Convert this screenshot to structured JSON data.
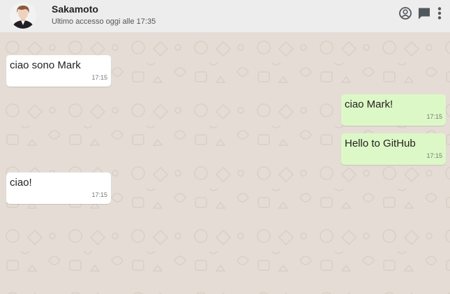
{
  "header": {
    "contact_name": "Sakamoto",
    "last_seen": "Ultimo accesso oggi alle 17:35",
    "icons": [
      "account-circle-icon",
      "chat-icon",
      "more-vertical-icon"
    ]
  },
  "messages": [
    {
      "direction": "in",
      "text": "ciao sono Mark",
      "time": "17:15"
    },
    {
      "direction": "out",
      "text": "ciao Mark!",
      "time": "17:15"
    },
    {
      "direction": "out",
      "text": "Hello to GitHub",
      "time": "17:15"
    },
    {
      "direction": "in",
      "text": "ciao!",
      "time": "17:15"
    }
  ],
  "colors": {
    "header_bg": "#ededed",
    "chat_bg": "#e5ddd5",
    "incoming_bubble": "#ffffff",
    "outgoing_bubble": "#dcf8c6"
  }
}
